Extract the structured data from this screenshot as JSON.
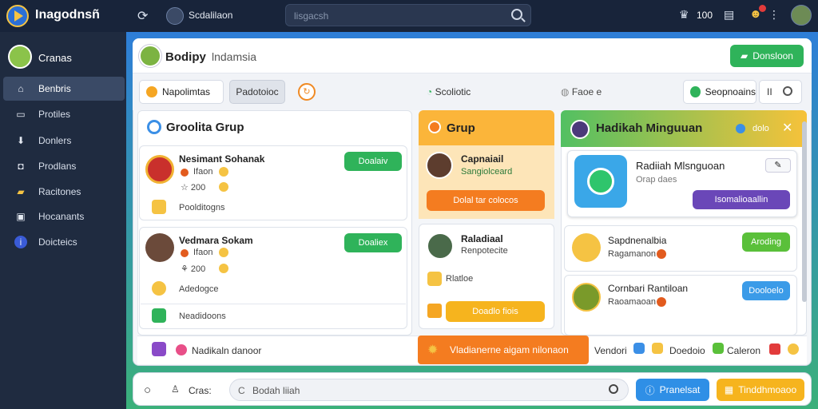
{
  "app": {
    "title": "Inagodnsñ"
  },
  "top": {
    "user_label": "Scdalilaon",
    "search_placeholder": "lisgacsh",
    "count": "100"
  },
  "sidebar": {
    "user": "Cranas",
    "items": [
      {
        "label": "Benbris",
        "icon": "home-icon"
      },
      {
        "label": "Protiles",
        "icon": "document-icon"
      },
      {
        "label": "Donlers",
        "icon": "download-icon"
      },
      {
        "label": "Prodlans",
        "icon": "lock-icon"
      },
      {
        "label": "Racitones",
        "icon": "folder-icon"
      },
      {
        "label": "Hocanants",
        "icon": "card-icon"
      },
      {
        "label": "Doicteics",
        "icon": "info-icon"
      }
    ]
  },
  "header": {
    "title": "Bodipy",
    "subtitle": "lndamsia",
    "action": "Donsloon"
  },
  "tabs": {
    "tab1": "Napolimtas",
    "tab2": "Padotoioc",
    "tab3": "Scoliotic",
    "tab4": "Faoe e",
    "seg": "Seopnoains",
    "tool": "II"
  },
  "col1": {
    "title": "Groolita Grup",
    "item1": {
      "name": "Nesimant Sohanak",
      "sub1": "Ifaon",
      "sub2": "200",
      "btn": "Doalaiv",
      "foot": "Poolditogns"
    },
    "item2": {
      "name": "Vedmara Sokam",
      "sub1": "Ifaon",
      "sub2": "200",
      "btn": "Doaliex",
      "foot": "Adedogce",
      "extra": "Neadidoons"
    }
  },
  "col2": {
    "title": "Grup",
    "card1": {
      "name": "Capnaiail",
      "sub": "Sangiolceard",
      "btn": "Dolal tar colocos"
    },
    "card2": {
      "name": "Raladiaal",
      "sub": "Renpotecite",
      "tag": "Rlatloe",
      "btn": "Doadlo fiois"
    }
  },
  "col3": {
    "title": "Hadikah Minguuan",
    "meta": "dolo",
    "card1": {
      "name": "Radiiah Mlsnguoan",
      "sub": "Orap daes",
      "btn": "Isomalioaallin"
    },
    "item1": {
      "name": "Sapdnenalbia",
      "sub": "Ragamanon",
      "btn": "Aroding"
    },
    "item2": {
      "name": "Cornbari Rantiloan",
      "sub": "Raoamaoan",
      "btn": "Dooloelo"
    }
  },
  "bottom_strip": {
    "left_label": "Nadikaln danoor",
    "orange": "Vladianerne aigam nilonaon",
    "r1": "Vendori",
    "r2": "Doedoio",
    "r3": "Caleron"
  },
  "footer": {
    "left": "Cras:",
    "input_placeholder": "Bodah liiah",
    "btn_blue": "Pranelsat",
    "btn_yellow": "Tinddhmoaoo"
  }
}
